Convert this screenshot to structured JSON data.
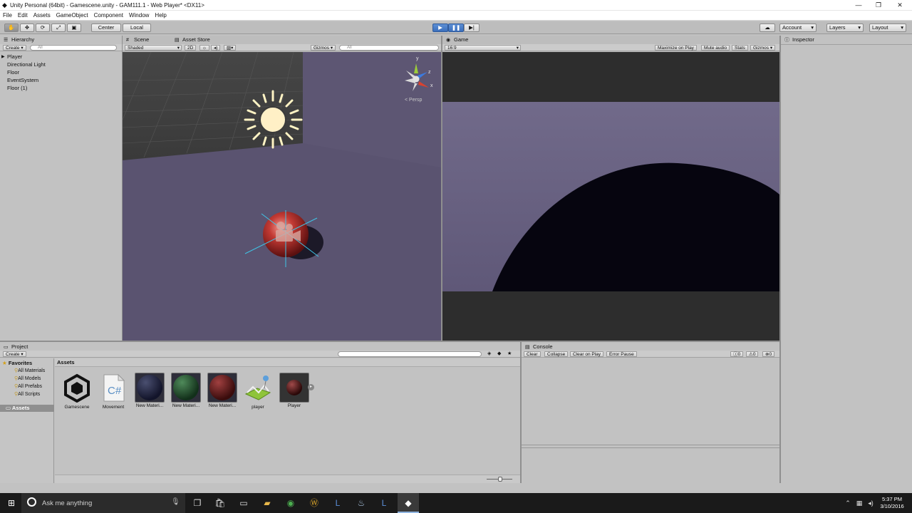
{
  "window": {
    "title": "Unity Personal (64bit) - Gamescene.unity - GAM111.1 - Web Player* <DX11>",
    "minimize": "—",
    "maximize": "❐",
    "close": "✕"
  },
  "menu": [
    "File",
    "Edit",
    "Assets",
    "GameObject",
    "Component",
    "Window",
    "Help"
  ],
  "toolbar": {
    "pivot_label": "Center",
    "space_label": "Local",
    "account_label": "Account",
    "layers_label": "Layers",
    "layout_label": "Layout"
  },
  "hierarchy": {
    "tab": "Hierarchy",
    "create": "Create",
    "search_placeholder": "All",
    "items": [
      "Player",
      "Directional Light",
      "Floor",
      "EventSystem",
      "Floor (1)"
    ]
  },
  "scene": {
    "tab": "Scene",
    "tab2": "Asset Store",
    "shading": "Shaded",
    "mode2d": "2D",
    "gizmos": "Gizmos",
    "search_placeholder": "All",
    "persp": "Persp"
  },
  "game": {
    "tab": "Game",
    "aspect": "16:9",
    "maximize_on_play": "Maximize on Play",
    "mute_audio": "Mute audio",
    "stats": "Stats",
    "gizmos": "Gizmos"
  },
  "inspector": {
    "tab": "Inspector"
  },
  "project": {
    "tab": "Project",
    "create": "Create",
    "favorites": "Favorites",
    "favorite_items": [
      "All Materials",
      "All Models",
      "All Prefabs",
      "All Scripts"
    ],
    "assets_root": "Assets",
    "breadcrumb": "Assets",
    "assets": [
      {
        "label": "Gamescene",
        "kind": "unity-scene-icon"
      },
      {
        "label": "Movement",
        "kind": "csharp-script-icon"
      },
      {
        "label": "New Materi...",
        "kind": "material",
        "color": "#1c1f33"
      },
      {
        "label": "New Materi...",
        "kind": "material",
        "color": "#1f3a24"
      },
      {
        "label": "New Materi...",
        "kind": "material",
        "color": "#4a1414"
      },
      {
        "label": "player",
        "kind": "model-icon"
      },
      {
        "label": "Player",
        "kind": "prefab",
        "color": "#3a0c0c"
      }
    ]
  },
  "console": {
    "tab": "Console",
    "buttons": [
      "Clear",
      "Collapse",
      "Clear on Play",
      "Error Pause"
    ],
    "counts": [
      "0",
      "0",
      "0"
    ]
  },
  "taskbar": {
    "search_placeholder": "Ask me anything",
    "time": "5:37 PM",
    "date": "3/10/2016"
  },
  "colors": {
    "floor": "#5a5370",
    "sky": "#3d3d3d",
    "game_floor": "#6a6384",
    "ball": "#06050f",
    "light_gizmo": "#fff3c4"
  }
}
